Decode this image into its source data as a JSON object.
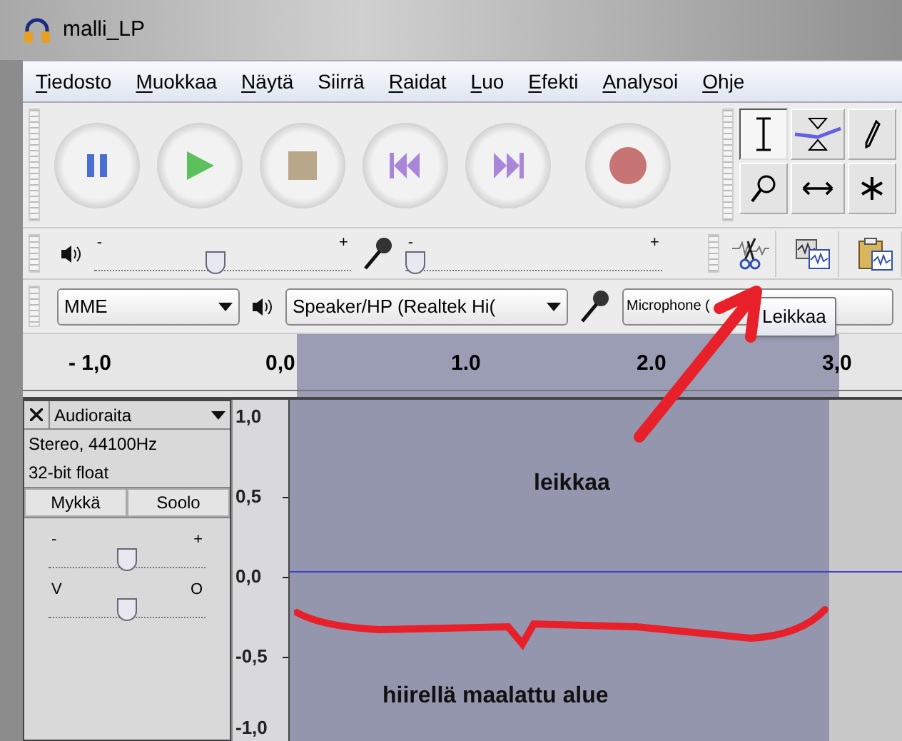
{
  "window": {
    "title": "malli_LP"
  },
  "menu": [
    {
      "label": "Tiedosto",
      "underlined": true
    },
    {
      "label": "Muokkaa",
      "underlined": true
    },
    {
      "label": "Näytä",
      "underlined": true
    },
    {
      "label": "Siirrä",
      "underlined": false
    },
    {
      "label": "Raidat",
      "underlined": true
    },
    {
      "label": "Luo",
      "underlined": true
    },
    {
      "label": "Efekti",
      "underlined": true
    },
    {
      "label": "Analysoi",
      "underlined": true
    },
    {
      "label": "Ohje",
      "underlined": true
    }
  ],
  "transport": [
    {
      "kind": "pause"
    },
    {
      "kind": "play"
    },
    {
      "kind": "stop"
    },
    {
      "kind": "skip-start"
    },
    {
      "kind": "skip-end"
    },
    {
      "kind": "record"
    }
  ],
  "tools": [
    {
      "kind": "select",
      "selected": true
    },
    {
      "kind": "envelope",
      "selected": false
    },
    {
      "kind": "draw",
      "selected": false
    },
    {
      "kind": "zoom",
      "selected": false
    },
    {
      "kind": "timeshift",
      "selected": false
    },
    {
      "kind": "multi",
      "selected": false
    }
  ],
  "mixer": {
    "output": {
      "min": "-",
      "max": "+",
      "level": 0.47
    },
    "input": {
      "min": "-",
      "max": "+",
      "level": 0.0
    }
  },
  "edit_tools": [
    {
      "kind": "cut"
    },
    {
      "kind": "copy"
    },
    {
      "kind": "paste"
    }
  ],
  "devices": {
    "host": "MME",
    "output": "Speaker/HP (Realtek Hi(",
    "input": "Microphone ("
  },
  "tooltip": "Leikkaa",
  "ruler": [
    "- 1,0",
    "0,0",
    "1.0",
    "2.0",
    "3,0"
  ],
  "track": {
    "name": "Audioraita",
    "info": [
      "Stereo, 44100Hz",
      "32-bit float"
    ],
    "buttons": [
      "Mykkä",
      "Soolo"
    ],
    "gain": {
      "min": "-",
      "max": "+",
      "level": 0.5
    },
    "pan": {
      "min": "V",
      "max": "O",
      "level": 0.5
    },
    "scale": [
      "1,0",
      "0,5",
      "0,0",
      "-0,5",
      "-1,0"
    ]
  },
  "annotations": [
    {
      "kind": "label",
      "text": "leikkaa"
    },
    {
      "kind": "label",
      "text": "hiirellä maalattu alue"
    }
  ]
}
